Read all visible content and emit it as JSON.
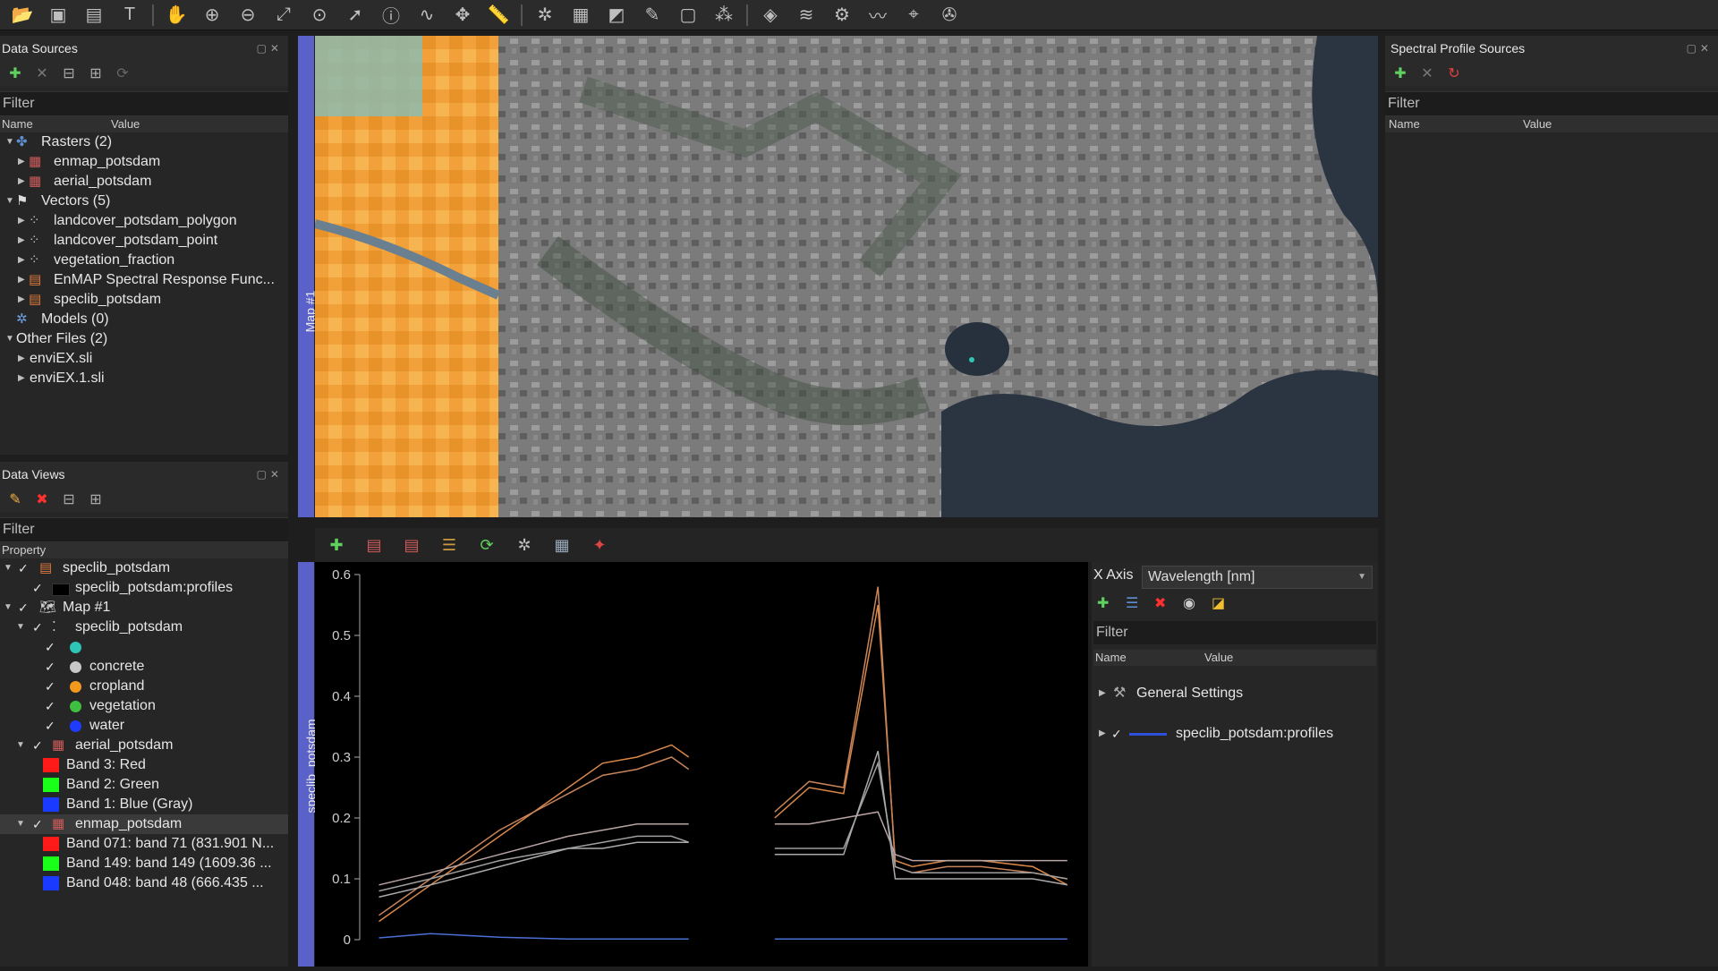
{
  "toolbar": {
    "icons": [
      "open-project-icon",
      "add-data-icon",
      "new-speclib-icon",
      "text-icon",
      "pan-icon",
      "zoom-in-icon",
      "zoom-out-icon",
      "zoom-full-icon",
      "zoom-pixel-icon",
      "select-feature-icon",
      "identify-icon",
      "spectral-profile-icon",
      "move-center-icon",
      "measure-icon",
      "settings-icon",
      "attribute-table-icon",
      "vector-edit-icon",
      "pencil-icon",
      "save-edits-icon",
      "digitize-icon",
      "google-earth-icon",
      "layers-icon",
      "processing-icon",
      "wave-icon",
      "location-icon",
      "satellite-icon"
    ]
  },
  "data_sources": {
    "title": "Data Sources",
    "filter_placeholder": "Filter",
    "col_name": "Name",
    "col_value": "Value",
    "rows": [
      {
        "label": "Rasters (2)",
        "level": 0,
        "expanded": true,
        "icon": "raster-group-icon"
      },
      {
        "label": "enmap_potsdam",
        "level": 1,
        "expanded": false,
        "icon": "raster-layer-icon"
      },
      {
        "label": "aerial_potsdam",
        "level": 1,
        "expanded": false,
        "icon": "raster-layer-icon"
      },
      {
        "label": "Vectors (5)",
        "level": 0,
        "expanded": true,
        "icon": "vector-group-icon"
      },
      {
        "label": "landcover_potsdam_polygon",
        "level": 1,
        "expanded": false,
        "icon": "vector-layer-icon"
      },
      {
        "label": "landcover_potsdam_point",
        "level": 1,
        "expanded": false,
        "icon": "vector-layer-icon"
      },
      {
        "label": "vegetation_fraction",
        "level": 1,
        "expanded": false,
        "icon": "vector-layer-icon"
      },
      {
        "label": "EnMAP Spectral Response Func...",
        "level": 1,
        "expanded": false,
        "icon": "speclib-icon"
      },
      {
        "label": "speclib_potsdam",
        "level": 1,
        "expanded": false,
        "icon": "speclib-icon"
      },
      {
        "label": "Models (0)",
        "level": 0,
        "expanded": null,
        "icon": "models-icon"
      },
      {
        "label": "Other Files (2)",
        "level": 0,
        "expanded": true,
        "icon": ""
      },
      {
        "label": "enviEX.sli",
        "level": 1,
        "expanded": false,
        "icon": ""
      },
      {
        "label": "enviEX.1.sli",
        "level": 1,
        "expanded": false,
        "icon": ""
      }
    ]
  },
  "data_views": {
    "title": "Data Views",
    "filter_placeholder": "Filter",
    "col_property": "Property",
    "rows": [
      {
        "label": "speclib_potsdam",
        "x": 70,
        "chk": 20,
        "arrow": 4,
        "icon": "speclib-icon",
        "sel": false
      },
      {
        "label": "speclib_potsdam:profiles",
        "x": 84,
        "chk": 36,
        "arrow": null,
        "icon": "profile-line-icon",
        "sel": false
      },
      {
        "label": "Map #1",
        "x": 70,
        "chk": 20,
        "arrow": 4,
        "icon": "map-icon",
        "sel": false
      },
      {
        "label": "speclib_potsdam",
        "x": 84,
        "chk": 36,
        "arrow": 18,
        "icon": "points-icon",
        "sel": false
      },
      {
        "label": "",
        "x": 100,
        "chk": 50,
        "arrow": null,
        "dot": "#2ec4b6",
        "sel": false
      },
      {
        "label": "concrete",
        "x": 100,
        "chk": 50,
        "arrow": null,
        "dot": "#c8c8c8",
        "sel": false
      },
      {
        "label": "cropland",
        "x": 100,
        "chk": 50,
        "arrow": null,
        "dot": "#f39a1e",
        "sel": false
      },
      {
        "label": "vegetation",
        "x": 100,
        "chk": 50,
        "arrow": null,
        "dot": "#3fbf3f",
        "sel": false
      },
      {
        "label": "water",
        "x": 100,
        "chk": 50,
        "arrow": null,
        "dot": "#1f3bff",
        "sel": false
      },
      {
        "label": "aerial_potsdam",
        "x": 84,
        "chk": 36,
        "arrow": 18,
        "icon": "raster-layer-icon",
        "sel": false
      },
      {
        "label": "Band 3: Red",
        "x": 74,
        "chk": null,
        "arrow": null,
        "sq": "#ff1a1a",
        "sel": false
      },
      {
        "label": "Band 2: Green",
        "x": 74,
        "chk": null,
        "arrow": null,
        "sq": "#1aff1a",
        "sel": false
      },
      {
        "label": "Band 1: Blue (Gray)",
        "x": 74,
        "chk": null,
        "arrow": null,
        "sq": "#1a3bff",
        "sel": false
      },
      {
        "label": "enmap_potsdam",
        "x": 84,
        "chk": 36,
        "arrow": 18,
        "icon": "raster-layer-icon",
        "sel": true
      },
      {
        "label": "Band 071: band 71 (831.901 N...",
        "x": 74,
        "chk": null,
        "arrow": null,
        "sq": "#ff1a1a",
        "sel": false
      },
      {
        "label": "Band 149: band 149 (1609.36 ...",
        "x": 74,
        "chk": null,
        "arrow": null,
        "sq": "#1aff1a",
        "sel": false
      },
      {
        "label": "Band 048: band 48 (666.435 ...",
        "x": 74,
        "chk": null,
        "arrow": null,
        "sq": "#1a3bff",
        "sel": false
      }
    ]
  },
  "map": {
    "label": "Map #1"
  },
  "spectral_view": {
    "label": "speclib_potsdam",
    "xaxis_label": "X Axis",
    "xaxis_value": "Wavelength [nm]",
    "filter_placeholder": "Filter",
    "col_name": "Name",
    "col_value": "Value",
    "rows": [
      {
        "label": "General Settings"
      },
      {
        "label": "speclib_potsdam:profiles"
      }
    ]
  },
  "spectral_sources": {
    "title": "Spectral Profile Sources",
    "filter_placeholder": "Filter",
    "col_name": "Name",
    "col_value": "Value"
  },
  "chart_data": {
    "type": "line",
    "title": "",
    "xlabel": "",
    "ylabel": "",
    "ylim": [
      0,
      0.6
    ],
    "xlim": [
      420,
      2500
    ],
    "y_ticks": [
      "0",
      "0.1",
      "0.2",
      "0.3",
      "0.4",
      "0.5",
      "0.6"
    ],
    "grid": false,
    "x": [
      450,
      600,
      800,
      1000,
      1100,
      1200,
      1300,
      1350,
      1500,
      1600,
      1700,
      1800,
      1900,
      1950,
      2000,
      2100,
      2200,
      2350,
      2450
    ],
    "series": [
      {
        "color": "#d9884a",
        "values": [
          0.03,
          0.09,
          0.17,
          0.25,
          0.29,
          0.3,
          0.32,
          0.3,
          null,
          0.2,
          0.25,
          0.24,
          0.55,
          0.13,
          0.12,
          0.13,
          0.13,
          0.12,
          0.09
        ]
      },
      {
        "color": "#c8845a",
        "values": [
          0.04,
          0.1,
          0.18,
          0.24,
          0.27,
          0.28,
          0.3,
          0.28,
          null,
          0.21,
          0.26,
          0.25,
          0.58,
          0.12,
          0.11,
          0.12,
          0.12,
          0.11,
          0.1
        ]
      },
      {
        "color": "#b9a4a4",
        "values": [
          0.09,
          0.11,
          0.14,
          0.17,
          0.18,
          0.19,
          0.19,
          0.19,
          null,
          0.19,
          0.19,
          0.2,
          0.21,
          0.14,
          0.13,
          0.13,
          0.13,
          0.13,
          0.13
        ]
      },
      {
        "color": "#9e9e9e",
        "values": [
          0.08,
          0.1,
          0.13,
          0.15,
          0.16,
          0.17,
          0.17,
          0.16,
          null,
          0.15,
          0.15,
          0.15,
          0.29,
          0.12,
          0.11,
          0.11,
          0.11,
          0.11,
          0.1
        ]
      },
      {
        "color": "#aaaaaa",
        "values": [
          0.07,
          0.09,
          0.12,
          0.15,
          0.15,
          0.16,
          0.16,
          0.16,
          null,
          0.14,
          0.14,
          0.14,
          0.31,
          0.1,
          0.1,
          0.1,
          0.1,
          0.1,
          0.09
        ]
      },
      {
        "color": "#4b6fd4",
        "values": [
          0.003,
          0.01,
          0.004,
          0.001,
          0.001,
          0.001,
          0.001,
          0.001,
          null,
          0.001,
          0.001,
          0.001,
          0.001,
          0.001,
          0.001,
          0.001,
          0.001,
          0.001,
          0.001
        ]
      }
    ]
  }
}
